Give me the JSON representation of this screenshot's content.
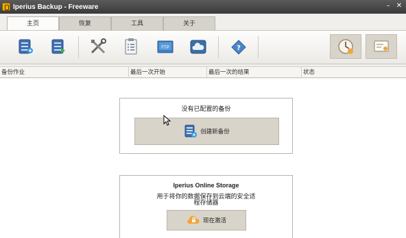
{
  "window": {
    "title": "Iperius Backup - Freeware",
    "minimize_icon": "minimize-icon",
    "close_icon": "close-icon"
  },
  "tabs": [
    {
      "label": "主页",
      "active": true
    },
    {
      "label": "恢复",
      "active": false
    },
    {
      "label": "工具",
      "active": false
    },
    {
      "label": "关于",
      "active": false
    }
  ],
  "toolbar": {
    "icons": [
      "new-backup-icon",
      "run-backup-icon",
      "tools-icon",
      "checklist-icon",
      "ftp-icon",
      "cloud-icon",
      "help-book-icon",
      "scheduler-clock-icon",
      "license-key-icon"
    ],
    "ftp_text": "FTP"
  },
  "table": {
    "columns": [
      "备份作业",
      "最后一次开始",
      "最后一次的结果",
      "状态"
    ]
  },
  "empty_panel": {
    "heading": "没有已配置的备份",
    "button_label": "创建新备份"
  },
  "storage_panel": {
    "title": "Iperius Online Storage",
    "description_line1": "用于将你的数据保存到云端的安全适",
    "description_line2": "程存储器",
    "button_label": "现在激活"
  },
  "colors": {
    "titlebar": "#3a3a3a",
    "button_bg": "#d9d4ca",
    "accent_orange": "#f2a43a",
    "accent_blue": "#3f7fc4"
  }
}
